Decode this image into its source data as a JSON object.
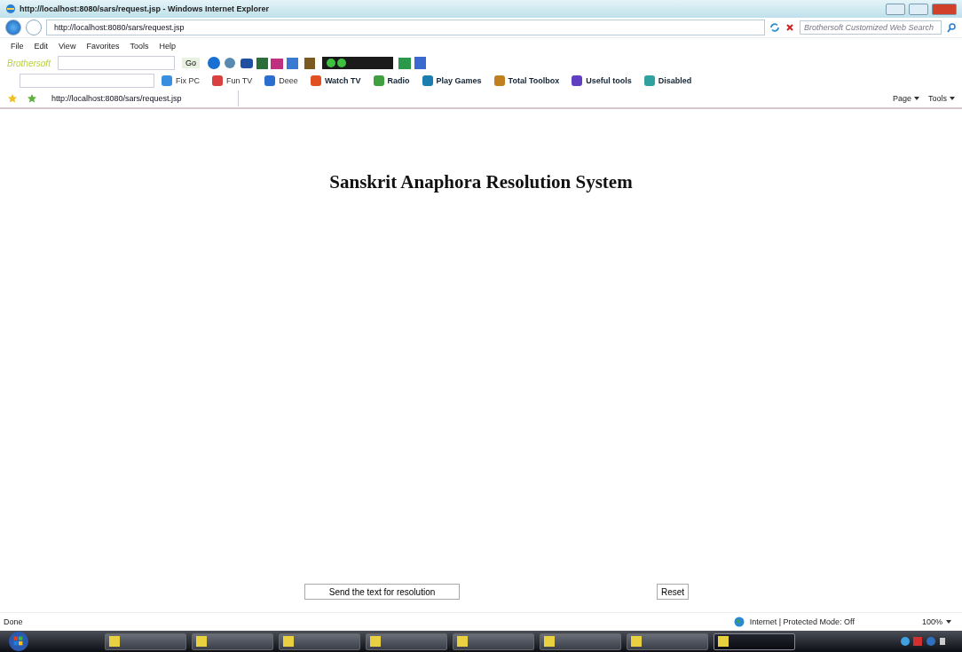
{
  "window": {
    "title": "http://localhost:8080/sars/request.jsp - Windows Internet Explorer"
  },
  "address_bar": {
    "url": "http://localhost:8080/sars/request.jsp",
    "search_placeholder": "Brothersoft Customized Web Search"
  },
  "menu": [
    "File",
    "Edit",
    "View",
    "Favorites",
    "Tools",
    "Help"
  ],
  "toolbar_1": {
    "brand": "Brothersoft",
    "go": "Go"
  },
  "toolbar_2": [
    {
      "label": "Fix PC",
      "bold": false
    },
    {
      "label": "Fun TV",
      "bold": false
    },
    {
      "label": "Deee",
      "bold": false
    },
    {
      "label": "Watch TV",
      "bold": true
    },
    {
      "label": "Radio",
      "bold": true
    },
    {
      "label": "Play Games",
      "bold": true
    },
    {
      "label": "Total Toolbox",
      "bold": true
    },
    {
      "label": "Useful tools",
      "bold": true
    },
    {
      "label": "Disabled",
      "bold": true
    }
  ],
  "tab": {
    "title": "http://localhost:8080/sars/request.jsp"
  },
  "command_bar": [
    "Page",
    "Tools"
  ],
  "page": {
    "heading": "Sanskrit Anaphora Resolution System",
    "buttons": [
      "Send the text for resolution",
      "Reset"
    ]
  },
  "status_bar": {
    "text": "Done",
    "zone": "Internet | Protected Mode: Off",
    "zoom": "100%"
  },
  "taskbar": [
    {
      "selected": false
    },
    {
      "selected": false
    },
    {
      "selected": false
    },
    {
      "selected": false
    },
    {
      "selected": false
    },
    {
      "selected": false
    },
    {
      "selected": false
    },
    {
      "selected": true
    }
  ]
}
